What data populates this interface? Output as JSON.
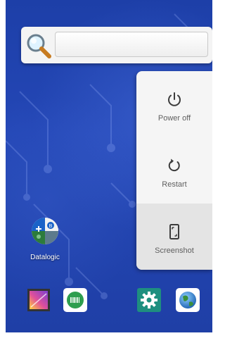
{
  "search": {
    "value": "",
    "placeholder": ""
  },
  "power_menu": {
    "items": [
      {
        "label": "Power off",
        "icon": "power-icon"
      },
      {
        "label": "Restart",
        "icon": "restart-icon"
      },
      {
        "label": "Screenshot",
        "icon": "screenshot-icon",
        "selected": true
      }
    ]
  },
  "home": {
    "apps": [
      {
        "label": "Datalogic",
        "icon": "datalogic-app-icon"
      }
    ]
  },
  "dock": {
    "icons": [
      "gallery-icon",
      "barcode-scanner-icon",
      "settings-icon",
      "browser-globe-icon"
    ]
  },
  "colors": {
    "wallpaper": "#2447b6",
    "menu_background": "#f5f5f5",
    "menu_selected": "#e4e4e4",
    "menu_text": "#5f5f5f",
    "settings_green": "#1e8f7f"
  }
}
